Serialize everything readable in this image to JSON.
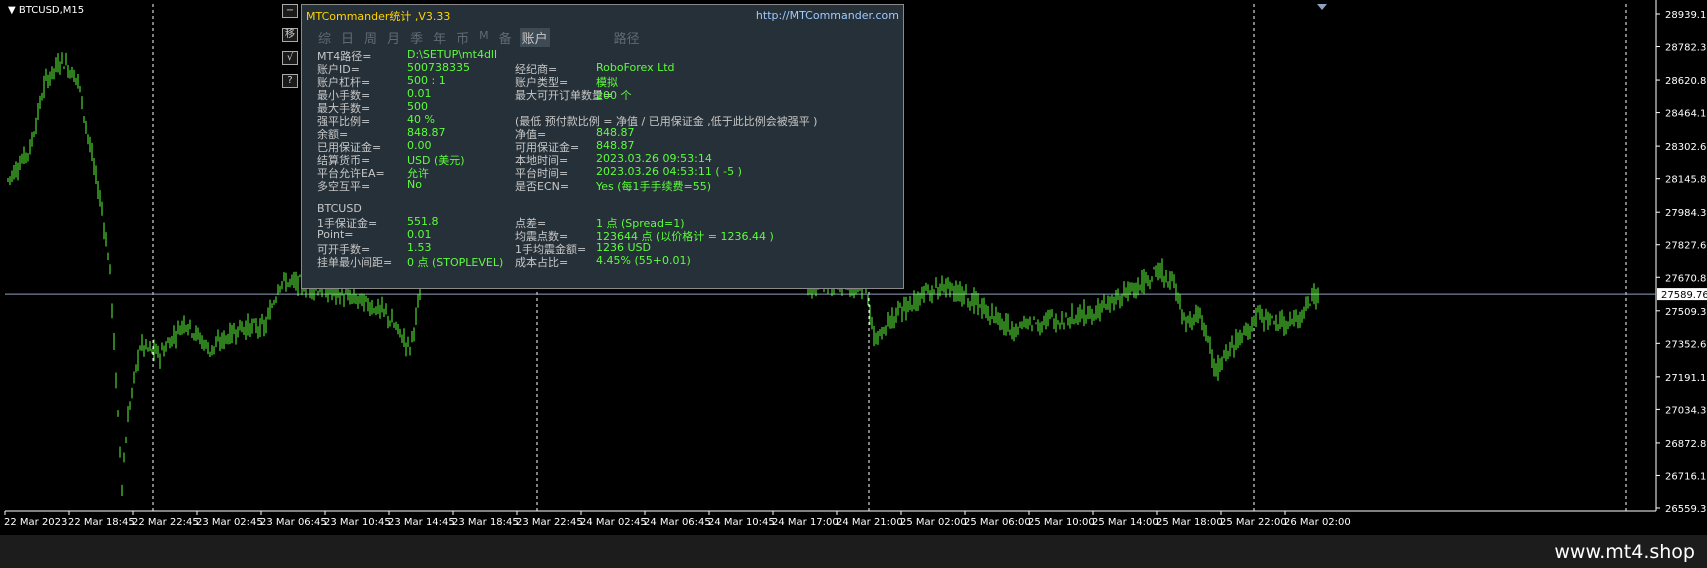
{
  "chart": {
    "symbol_label": "BTCUSD,M15",
    "price_axis": [
      "28939.10",
      "28782.35",
      "28620.85",
      "28464.10",
      "28302.60",
      "28145.85",
      "27984.35",
      "27827.60",
      "27670.85",
      "27509.35",
      "27352.60",
      "27191.10",
      "27034.35",
      "26872.85",
      "26716.10",
      "26559.35"
    ],
    "current_price": "27589.76",
    "time_axis": [
      "22 Mar 2023",
      "22 Mar 18:45",
      "22 Mar 22:45",
      "23 Mar 02:45",
      "23 Mar 06:45",
      "23 Mar 10:45",
      "23 Mar 14:45",
      "23 Mar 18:45",
      "23 Mar 22:45",
      "24 Mar 02:45",
      "24 Mar 06:45",
      "24 Mar 10:45",
      "24 Mar 17:00",
      "24 Mar 21:00",
      "25 Mar 02:00",
      "25 Mar 06:00",
      "25 Mar 10:00",
      "25 Mar 14:00",
      "25 Mar 18:00",
      "25 Mar 22:00",
      "26 Mar 02:00"
    ],
    "candle_color": "#5dfd3c",
    "price_line_color": "#8fa3c0"
  },
  "side_buttons": [
    "−",
    "移",
    "√",
    "?"
  ],
  "panel": {
    "title": "MTCommander统计 ,V3.33",
    "url": "http://MTCommander.com",
    "tabs": [
      "综",
      "日",
      "周",
      "月",
      "季",
      "年",
      "币",
      "M",
      "备",
      "账户",
      "路径"
    ],
    "account_rows": [
      {
        "l1": "MT4路径=",
        "v1": "D:\\SETUP\\mt4dll",
        "l2": "",
        "v2": ""
      },
      {
        "l1": "账户ID=",
        "v1": "500738335",
        "l2": "经纪商=",
        "v2": "RoboForex Ltd"
      },
      {
        "l1": "账户杠杆=",
        "v1": "500 : 1",
        "l2": "账户类型=",
        "v2": "模拟"
      },
      {
        "l1": "最小手数=",
        "v1": "0.01",
        "l2": "最大可开订单数量=",
        "v2": "200 个"
      },
      {
        "l1": "最大手数=",
        "v1": "500",
        "l2": "",
        "v2": ""
      },
      {
        "l1": "强平比例=",
        "v1": "40 %",
        "l2": "(最低 预付款比例 = 净值 / 已用保证金 ,低于此比例会被强平 )",
        "v2": ""
      },
      {
        "l1": "余额=",
        "v1": "848.87",
        "l2": "净值=",
        "v2": "848.87"
      },
      {
        "l1": "已用保证金=",
        "v1": "0.00",
        "l2": "可用保证金=",
        "v2": "848.87"
      },
      {
        "l1": "结算货币=",
        "v1": "USD (美元)",
        "l2": "本地时间=",
        "v2": "2023.03.26 09:53:14"
      },
      {
        "l1": "平台允许EA=",
        "v1": "允许",
        "l2": "平台时间=",
        "v2": "2023.03.26 04:53:11    ( -5 )"
      },
      {
        "l1": "多空互平=",
        "v1": "No",
        "l2": "是否ECN=",
        "v2": "Yes (每1手手续费=55)"
      }
    ],
    "symbol_title": "BTCUSD",
    "symbol_rows": [
      {
        "l1": "1手保证金=",
        "v1": "551.8",
        "l2": "点差=",
        "v2": "1 点    (Spread=1)"
      },
      {
        "l1": "Point=",
        "v1": "0.01",
        "l2": "均震点数=",
        "v2": "123644   点 (以价格计 = 1236.44 )"
      },
      {
        "l1": "可开手数=",
        "v1": "1.53",
        "l2": "1手均震金额=",
        "v2": "1236    USD"
      },
      {
        "l1": "挂单最小间距=",
        "v1": "0 点  (STOPLEVEL)",
        "l2": "成本占比=",
        "v2": "4.45% (55+0.01)"
      }
    ]
  },
  "watermark": "www.mt4.shop"
}
